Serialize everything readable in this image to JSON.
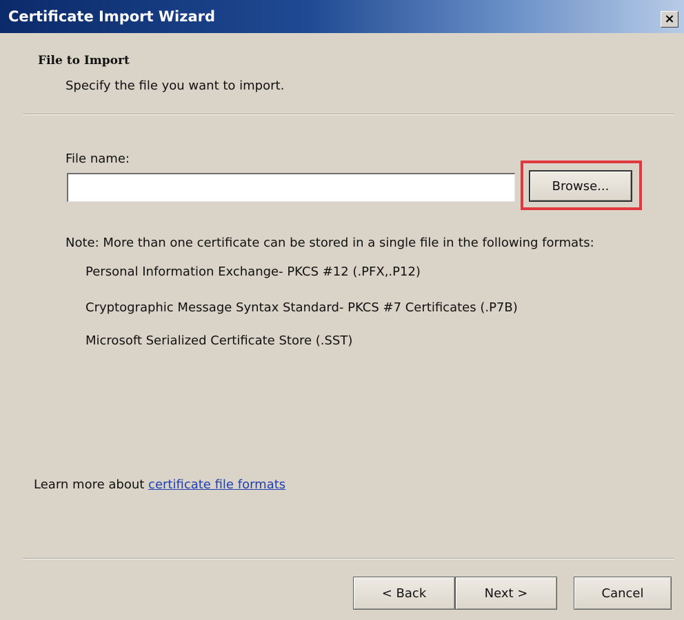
{
  "window": {
    "title": "Certificate Import Wizard",
    "close_glyph": "×"
  },
  "header": {
    "title": "File to Import",
    "subtitle": "Specify the file you want to import."
  },
  "file": {
    "label": "File name:",
    "value": "",
    "placeholder": ""
  },
  "browse": {
    "label": "Browse...",
    "highlight_color": "#e0383e"
  },
  "note": {
    "text": "Note:  More than one certificate can be stored in a single file in the following formats:",
    "formats": [
      "Personal Information Exchange- PKCS #12 (.PFX,.P12)",
      "Cryptographic Message Syntax Standard- PKCS #7 Certificates (.P7B)",
      "Microsoft Serialized Certificate Store (.SST)"
    ]
  },
  "learn_more": {
    "prefix": "Learn more about ",
    "link": "certificate file formats"
  },
  "footer": {
    "back": "< Back",
    "next": "Next >",
    "cancel": "Cancel"
  },
  "colors": {
    "dialog_bg": "#d9d3c8",
    "titlebar_start": "#0b2a6a",
    "titlebar_end": "#b8cbe6",
    "link": "#1f3fb3"
  }
}
